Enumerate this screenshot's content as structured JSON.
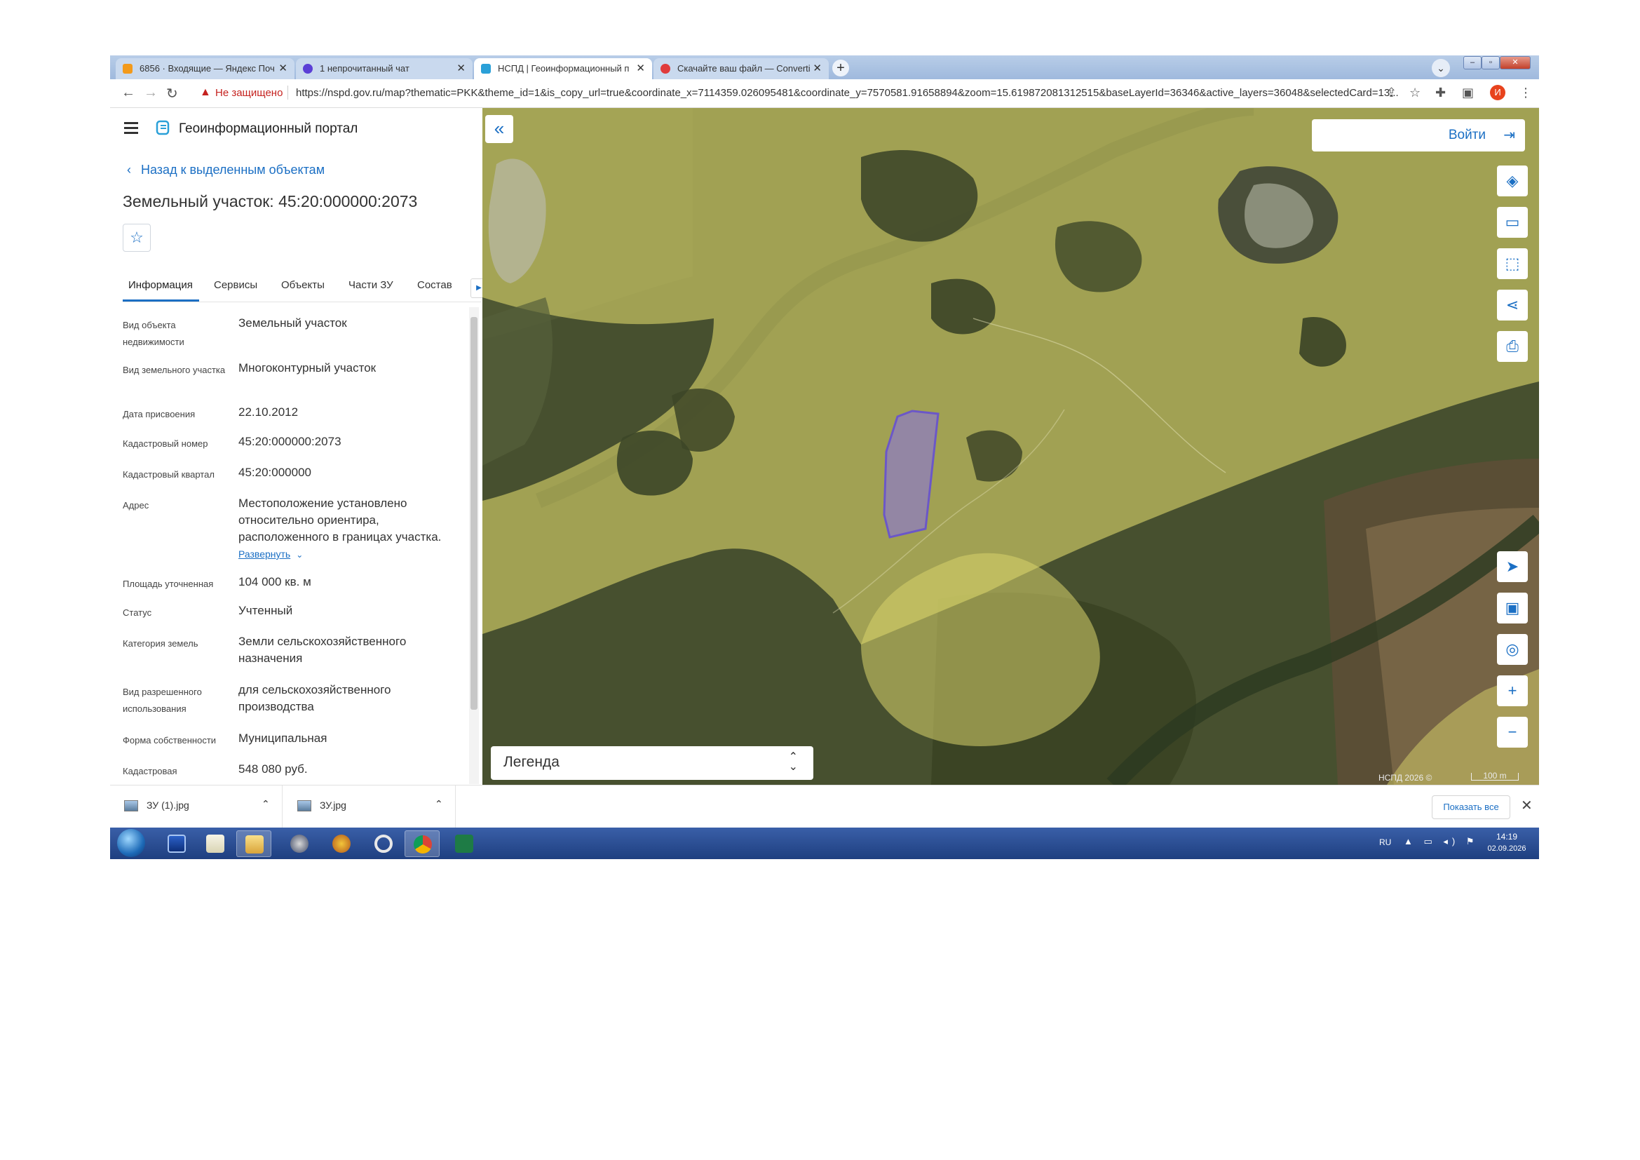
{
  "browser": {
    "tabs": [
      {
        "title": "6856 · Входящие — Яндекс Поч",
        "active": false,
        "favicon_color": "#f39a1b"
      },
      {
        "title": "1 непрочитанный чат",
        "active": false,
        "favicon_color": "#5b3fd6"
      },
      {
        "title": "НСПД | Геоинформационный п",
        "active": true,
        "favicon_color": "#2aa0d8"
      },
      {
        "title": "Скачайте ваш файл — Converti",
        "active": false,
        "favicon_color": "#e03b3b"
      }
    ],
    "new_tab": "+",
    "tab_search": "⌄",
    "window_buttons": {
      "minimize": "‒",
      "maximize": "▫",
      "close": "✕"
    },
    "not_secure": "Не защищено",
    "url": "https://nspd.gov.ru/map?thematic=PKK&theme_id=1&is_copy_url=true&coordinate_x=7114359.026095481&coordinate_y=7570581.91658894&zoom=15.619872081312515&baseLayerId=36346&active_layers=36048&selectedCard=13...",
    "profile_initial": "И"
  },
  "sidebar": {
    "portal_name": "Геоинформационный портал",
    "back_link": "Назад к выделенным объектам",
    "title": "Земельный участок: 45:20:000000:2073",
    "tabs": [
      "Информация",
      "Сервисы",
      "Объекты",
      "Части ЗУ",
      "Состав"
    ],
    "tabs_next": "▶",
    "properties": [
      {
        "label": "Вид объекта недвижимости",
        "value": "Земельный участок"
      },
      {
        "label": "Вид земельного участка",
        "value": "Многоконтурный участок"
      },
      {
        "label": "Дата присвоения",
        "value": "22.10.2012"
      },
      {
        "label": "Кадастровый номер",
        "value": "45:20:000000:2073"
      },
      {
        "label": "Кадастровый квартал",
        "value": "45:20:000000"
      },
      {
        "label": "Адрес",
        "value": "Местоположение установлено относительно ориентира, расположенного в границах участка."
      },
      {
        "label": "Площадь уточненная",
        "value": "104 000 кв. м"
      },
      {
        "label": "Статус",
        "value": "Учтенный"
      },
      {
        "label": "Категория земель",
        "value": "Земли сельскохозяйственного назначения"
      },
      {
        "label": "Вид разрешенного использования",
        "value": "для сельскохозяйственного производства"
      },
      {
        "label": "Форма собственности",
        "value": "Муниципальная"
      },
      {
        "label": "Кадастровая",
        "value": "548 080 руб."
      }
    ],
    "expand_link": "Развернуть"
  },
  "map": {
    "login_label": "Войти",
    "legend_label": "Легенда",
    "copyright": "НСПД 2026 ©",
    "scale": "100 m",
    "colors": {
      "zone_fill": "#d9d36b",
      "parcel_outline": "#5a3ff0",
      "parcel_fill": "#8f7dbf"
    }
  },
  "downloads": {
    "items": [
      {
        "name": "ЗУ (1).jpg"
      },
      {
        "name": "ЗУ.jpg"
      }
    ],
    "show_all": "Показать все",
    "close": "✕"
  },
  "taskbar": {
    "lang": "RU",
    "time": "14:19",
    "date": "02.09.2026"
  }
}
